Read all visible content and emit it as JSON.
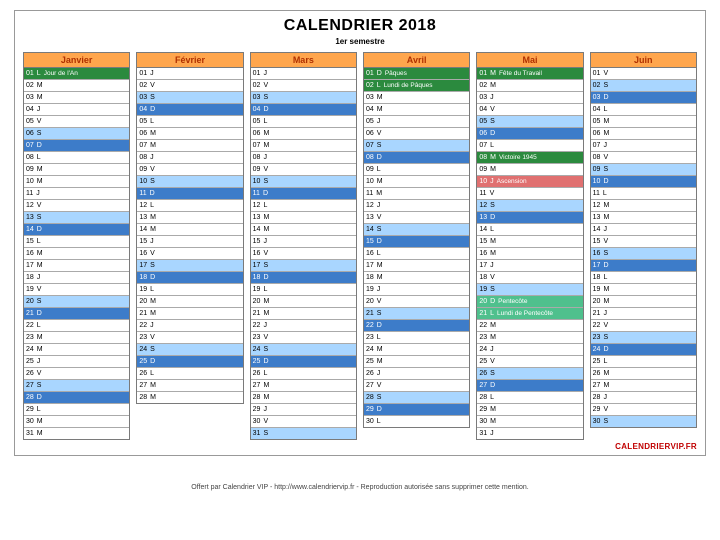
{
  "title": "CALENDRIER 2018",
  "subtitle": "1er semestre",
  "brand": "CALENDRIERVIP.FR",
  "footer": "Offert par Calendrier VIP - http://www.calendriervip.fr - Reproduction autorisée sans supprimer cette mention.",
  "day_letters": [
    "L",
    "M",
    "M",
    "J",
    "V",
    "S",
    "D"
  ],
  "months": [
    {
      "name": "Janvier",
      "first_weekday": 0,
      "num_days": 31,
      "specials": {
        "1": {
          "class": "c-holiday",
          "label": "Jour de l'An"
        },
        "6": {
          "class": "c-sat"
        },
        "7": {
          "class": "c-sun"
        },
        "13": {
          "class": "c-sat"
        },
        "14": {
          "class": "c-sun"
        },
        "20": {
          "class": "c-sat"
        },
        "21": {
          "class": "c-sun"
        },
        "27": {
          "class": "c-sat"
        },
        "28": {
          "class": "c-sun"
        }
      }
    },
    {
      "name": "Février",
      "first_weekday": 3,
      "num_days": 28,
      "specials": {
        "3": {
          "class": "c-sat"
        },
        "4": {
          "class": "c-sun"
        },
        "10": {
          "class": "c-sat"
        },
        "11": {
          "class": "c-sun"
        },
        "17": {
          "class": "c-sat"
        },
        "18": {
          "class": "c-sun"
        },
        "24": {
          "class": "c-sat"
        },
        "25": {
          "class": "c-sun"
        }
      }
    },
    {
      "name": "Mars",
      "first_weekday": 3,
      "num_days": 31,
      "specials": {
        "3": {
          "class": "c-sat"
        },
        "4": {
          "class": "c-sun"
        },
        "10": {
          "class": "c-sat"
        },
        "11": {
          "class": "c-sun"
        },
        "17": {
          "class": "c-sat"
        },
        "18": {
          "class": "c-sun"
        },
        "24": {
          "class": "c-sat"
        },
        "25": {
          "class": "c-sun"
        },
        "31": {
          "class": "c-sat"
        }
      }
    },
    {
      "name": "Avril",
      "first_weekday": 6,
      "num_days": 30,
      "specials": {
        "1": {
          "class": "c-holiday",
          "label": "Pâques"
        },
        "2": {
          "class": "c-holiday",
          "label": "Lundi de Pâques"
        },
        "7": {
          "class": "c-sat"
        },
        "8": {
          "class": "c-sun"
        },
        "14": {
          "class": "c-sat"
        },
        "15": {
          "class": "c-sun"
        },
        "21": {
          "class": "c-sat"
        },
        "22": {
          "class": "c-sun"
        },
        "28": {
          "class": "c-sat"
        },
        "29": {
          "class": "c-sun"
        }
      }
    },
    {
      "name": "Mai",
      "first_weekday": 1,
      "num_days": 31,
      "specials": {
        "1": {
          "class": "c-holiday",
          "label": "Fête du Travail"
        },
        "5": {
          "class": "c-sat"
        },
        "6": {
          "class": "c-sun"
        },
        "8": {
          "class": "c-holiday",
          "label": "Victoire 1945"
        },
        "10": {
          "class": "c-bridge",
          "label": "Ascension"
        },
        "12": {
          "class": "c-sat"
        },
        "13": {
          "class": "c-sun"
        },
        "19": {
          "class": "c-sat"
        },
        "20": {
          "class": "c-holiday2",
          "label": "Pentecôte"
        },
        "21": {
          "class": "c-holiday2",
          "label": "Lundi de Pentecôte"
        },
        "26": {
          "class": "c-sat"
        },
        "27": {
          "class": "c-sun"
        }
      }
    },
    {
      "name": "Juin",
      "first_weekday": 4,
      "num_days": 30,
      "specials": {
        "2": {
          "class": "c-sat"
        },
        "3": {
          "class": "c-sun"
        },
        "9": {
          "class": "c-sat"
        },
        "10": {
          "class": "c-sun"
        },
        "16": {
          "class": "c-sat"
        },
        "17": {
          "class": "c-sun"
        },
        "23": {
          "class": "c-sat"
        },
        "24": {
          "class": "c-sun"
        },
        "30": {
          "class": "c-sat"
        }
      }
    }
  ]
}
